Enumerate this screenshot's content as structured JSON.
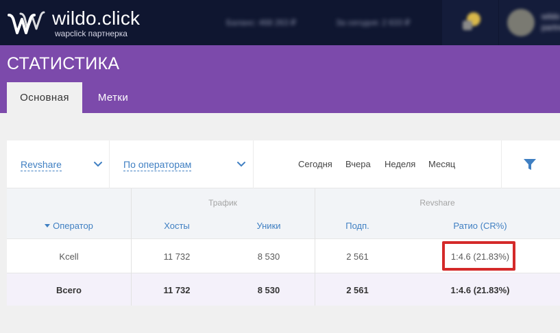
{
  "header": {
    "brand_name": "wildo.click",
    "brand_sub": "wapclick партнерка",
    "balance_1": "Баланс: 468 263 ₽",
    "balance_2": "За сегодня: 2 633 ₽",
    "user_name": "wildo",
    "user_sub": "partner",
    "colors": {
      "bg": "#0f1630",
      "accent": "#7c4aab"
    }
  },
  "page": {
    "title": "СТАТИСТИКА",
    "tabs": [
      {
        "label": "Основная",
        "active": true
      },
      {
        "label": "Метки",
        "active": false
      }
    ]
  },
  "filters": {
    "program": "Revshare",
    "group_by": "По операторам",
    "periods": [
      "Сегодня",
      "Вчера",
      "Неделя",
      "Месяц"
    ],
    "filter_icon": "filter-icon"
  },
  "table": {
    "groups": {
      "traffic": "Трафик",
      "revshare": "Revshare"
    },
    "columns": {
      "operator": "Оператор",
      "hosts": "Хосты",
      "uniques": "Уники",
      "subs": "Подп.",
      "ratio": "Ратио (CR%)"
    },
    "rows": [
      {
        "operator": "Kcell",
        "hosts": "11 732",
        "uniques": "8 530",
        "subs": "2 561",
        "ratio": "1:4.6 (21.83%)"
      }
    ],
    "total": {
      "label": "Всего",
      "hosts": "11 732",
      "uniques": "8 530",
      "subs": "2 561",
      "ratio": "1:4.6 (21.83%)"
    }
  }
}
